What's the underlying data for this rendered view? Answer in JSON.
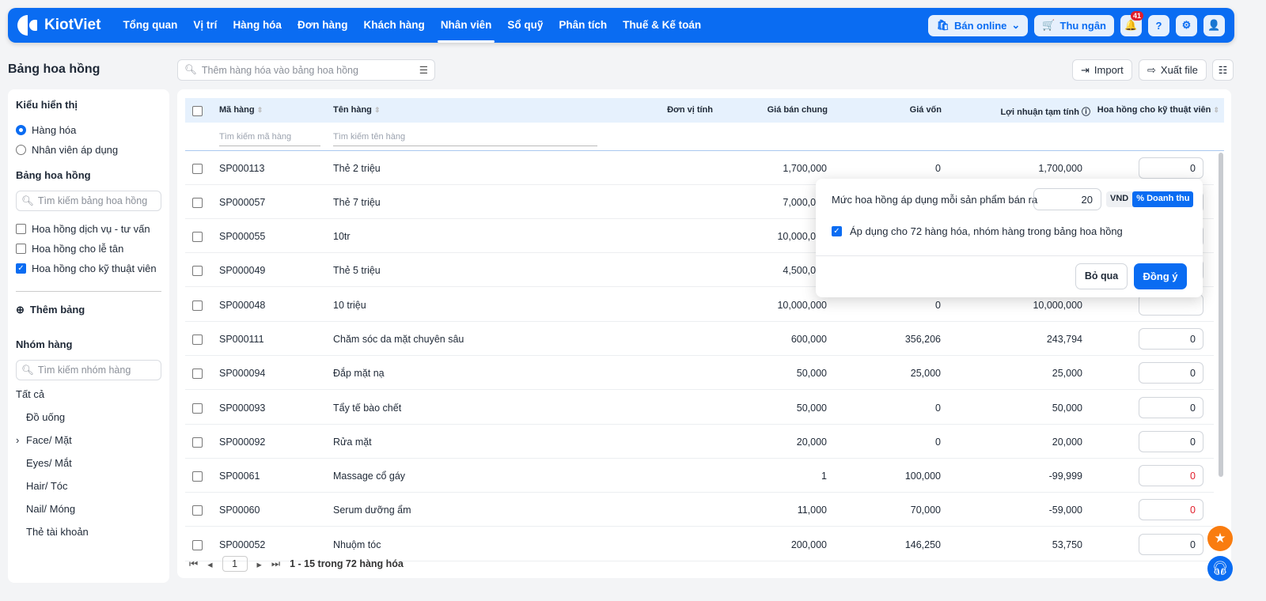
{
  "nav": {
    "brand": "KiotViet",
    "items": [
      "Tổng quan",
      "Vị trí",
      "Hàng hóa",
      "Đơn hàng",
      "Khách hàng",
      "Nhân viên",
      "Sổ quỹ",
      "Phân tích",
      "Thuế & Kế toán"
    ],
    "active": 5,
    "ban_online": "Bán online",
    "thu_ngan": "Thu ngân",
    "notif_count": "41"
  },
  "page": {
    "title": "Bảng hoa hồng",
    "search_placeholder": "Thêm hàng hóa vào bảng hoa hồng",
    "import": "Import",
    "export": "Xuất file"
  },
  "sidebar": {
    "display_title": "Kiểu hiển thị",
    "display_options": [
      "Hàng hóa",
      "Nhân viên áp dụng"
    ],
    "table_title": "Bảng hoa hồng",
    "table_search": "Tìm kiếm bảng hoa hồng",
    "tables": [
      {
        "label": "Hoa hồng dịch vụ - tư vấn",
        "checked": false
      },
      {
        "label": "Hoa hồng cho lễ tân",
        "checked": false
      },
      {
        "label": "Hoa hồng cho kỹ thuật viên",
        "checked": true
      }
    ],
    "add_table": "Thêm bảng",
    "group_title": "Nhóm hàng",
    "group_search": "Tìm kiếm nhóm hàng",
    "all": "Tất cả",
    "groups": [
      "Đồ uống",
      "Face/ Mặt",
      "Eyes/ Mắt",
      "Hair/ Tóc",
      "Nail/ Móng",
      "Thẻ tài khoản"
    ]
  },
  "table": {
    "headers": [
      "Mã hàng",
      "Tên hàng",
      "Đơn vị tính",
      "Giá bán chung",
      "Giá vốn",
      "Lợi nhuận tạm tính",
      "Hoa hồng cho kỹ thuật viên"
    ],
    "filter_code": "Tìm kiếm mã hàng",
    "filter_name": "Tìm kiếm tên hàng",
    "rows": [
      {
        "code": "SP000113",
        "name": "Thẻ 2 triệu",
        "price": "1,700,000",
        "cost": "0",
        "profit": "1,700,000",
        "commission": "0"
      },
      {
        "code": "SP000057",
        "name": "Thẻ 7 triệu",
        "price": "7,000,000",
        "cost": "",
        "profit": "",
        "commission": ""
      },
      {
        "code": "SP000055",
        "name": "10tr",
        "price": "10,000,000",
        "cost": "",
        "profit": "",
        "commission": ""
      },
      {
        "code": "SP000049",
        "name": "Thẻ 5 triệu",
        "price": "4,500,000",
        "cost": "",
        "profit": "",
        "commission": ""
      },
      {
        "code": "SP000048",
        "name": "10 triệu",
        "price": "10,000,000",
        "cost": "0",
        "profit": "10,000,000",
        "commission": ""
      },
      {
        "code": "SP000111",
        "name": "Chăm sóc da mặt chuyên sâu",
        "price": "600,000",
        "cost": "356,206",
        "profit": "243,794",
        "commission": "0"
      },
      {
        "code": "SP000094",
        "name": "Đắp mặt nạ",
        "price": "50,000",
        "cost": "25,000",
        "profit": "25,000",
        "commission": "0"
      },
      {
        "code": "SP000093",
        "name": "Tẩy tế bào chết",
        "price": "50,000",
        "cost": "0",
        "profit": "50,000",
        "commission": "0"
      },
      {
        "code": "SP000092",
        "name": "Rửa mặt",
        "price": "20,000",
        "cost": "0",
        "profit": "20,000",
        "commission": "0"
      },
      {
        "code": "SP00061",
        "name": "Massage cổ gáy",
        "price": "1",
        "cost": "100,000",
        "profit": "-99,999",
        "commission": "0"
      },
      {
        "code": "SP00060",
        "name": "Serum dưỡng ẩm",
        "price": "11,000",
        "cost": "70,000",
        "profit": "-59,000",
        "commission": "0"
      },
      {
        "code": "SP000052",
        "name": "Nhuộm tóc",
        "price": "200,000",
        "cost": "146,250",
        "profit": "53,750",
        "commission": "0"
      }
    ]
  },
  "pagination": {
    "page": "1",
    "summary": "1 - 15 trong 72 hàng hóa"
  },
  "popup": {
    "label": "Mức hoa hồng áp dụng mỗi sản phẩm bán ra",
    "value": "20",
    "unit_vnd": "VND",
    "unit_percent": "% Doanh thu",
    "apply_label": "Áp dụng cho 72 hàng hóa, nhóm hàng trong bảng hoa hồng",
    "apply_checked": true,
    "cancel": "Bỏ qua",
    "ok": "Đồng ý"
  },
  "colors": {
    "brand": "#0a6cf2",
    "negative": "#e11d2a"
  }
}
